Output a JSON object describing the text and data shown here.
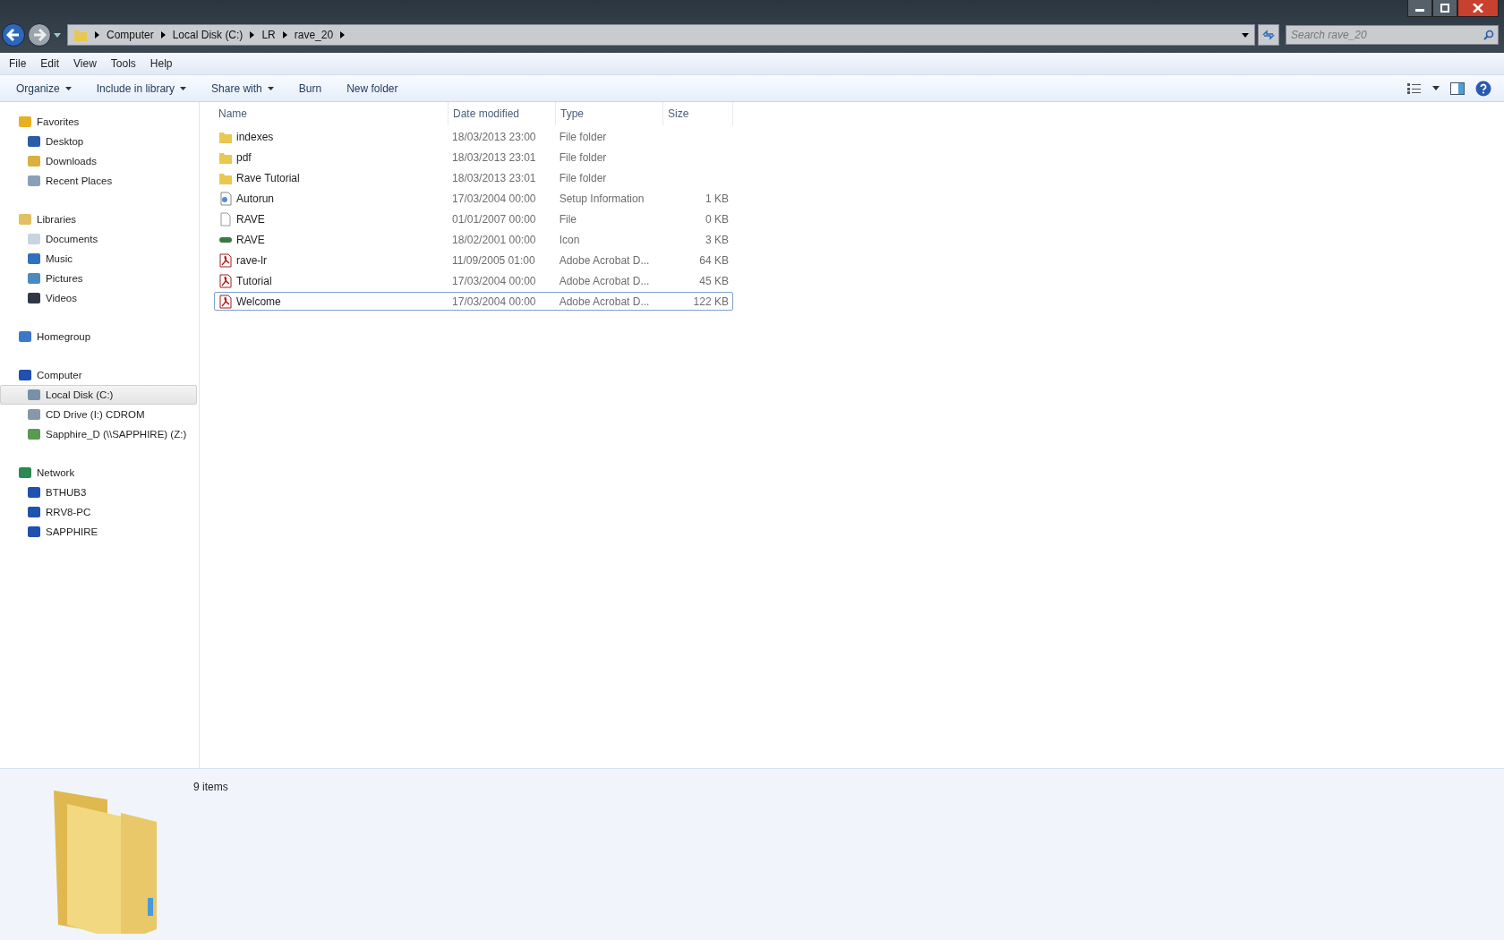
{
  "address_bar": {
    "crumbs": [
      "Computer",
      "Local Disk (C:)",
      "LR",
      "rave_20"
    ]
  },
  "search": {
    "placeholder": "Search rave_20"
  },
  "menu": [
    "File",
    "Edit",
    "View",
    "Tools",
    "Help"
  ],
  "toolbar": [
    {
      "label": "Organize",
      "dropdown": true
    },
    {
      "label": "Include in library",
      "dropdown": true
    },
    {
      "label": "Share with",
      "dropdown": true
    },
    {
      "label": "Burn",
      "dropdown": false
    },
    {
      "label": "New folder",
      "dropdown": false
    }
  ],
  "sidebar": [
    {
      "label": "Favorites",
      "kind": "favorites",
      "selected": false,
      "children": [
        {
          "label": "Desktop",
          "kind": "desktop",
          "selected": false
        },
        {
          "label": "Downloads",
          "kind": "downloads",
          "selected": false
        },
        {
          "label": "Recent Places",
          "kind": "recent",
          "selected": false
        }
      ]
    },
    {
      "label": "Libraries",
      "kind": "libraries",
      "selected": false,
      "children": [
        {
          "label": "Documents",
          "kind": "documents",
          "selected": false
        },
        {
          "label": "Music",
          "kind": "music",
          "selected": false
        },
        {
          "label": "Pictures",
          "kind": "pictures",
          "selected": false
        },
        {
          "label": "Videos",
          "kind": "videos",
          "selected": false
        }
      ]
    },
    {
      "label": "Homegroup",
      "kind": "homegroup",
      "selected": false
    },
    {
      "label": "Computer",
      "kind": "computer",
      "selected": false,
      "children": [
        {
          "label": "Local Disk (C:)",
          "kind": "disk",
          "selected": true
        },
        {
          "label": "CD Drive (I:) CDROM",
          "kind": "cd",
          "selected": false
        },
        {
          "label": "Sapphire_D (\\\\SAPPHIRE) (Z:)",
          "kind": "netdrive",
          "selected": false
        }
      ]
    },
    {
      "label": "Network",
      "kind": "network",
      "selected": false,
      "children": [
        {
          "label": "BTHUB3",
          "kind": "pc",
          "selected": false
        },
        {
          "label": "RRV8-PC",
          "kind": "pc",
          "selected": false
        },
        {
          "label": "SAPPHIRE",
          "kind": "pc",
          "selected": false
        }
      ]
    }
  ],
  "table": {
    "columns": [
      "Name",
      "Date modified",
      "Type",
      "Size"
    ],
    "rows": [
      {
        "name": "indexes",
        "kind": "folder",
        "date": "18/03/2013 23:00",
        "type": "File folder",
        "focused": false
      },
      {
        "name": "pdf",
        "kind": "folder",
        "date": "18/03/2013 23:01",
        "type": "File folder",
        "focused": false
      },
      {
        "name": "Rave Tutorial",
        "kind": "folder",
        "date": "18/03/2013 23:01",
        "type": "File folder",
        "focused": false
      },
      {
        "name": "Autorun",
        "kind": "setup",
        "date": "17/03/2004 00:00",
        "type": "Setup Information",
        "size": "1 KB",
        "focused": false
      },
      {
        "name": "RAVE",
        "kind": "file",
        "date": "01/01/2007 00:00",
        "type": "File",
        "size": "0 KB",
        "focused": false
      },
      {
        "name": "RAVE",
        "kind": "icon",
        "date": "18/02/2001 00:00",
        "type": "Icon",
        "size": "3 KB",
        "focused": false
      },
      {
        "name": "rave-lr",
        "kind": "pdf",
        "date": "11/09/2005 01:00",
        "type": "Adobe Acrobat D...",
        "size": "64 KB",
        "focused": false
      },
      {
        "name": "Tutorial",
        "kind": "pdf",
        "date": "17/03/2004 00:00",
        "type": "Adobe Acrobat D...",
        "size": "45 KB",
        "focused": false
      },
      {
        "name": "Welcome",
        "kind": "pdf",
        "date": "17/03/2004 00:00",
        "type": "Adobe Acrobat D...",
        "size": "122 KB",
        "focused": true
      }
    ]
  },
  "details": {
    "count": "9 items"
  }
}
